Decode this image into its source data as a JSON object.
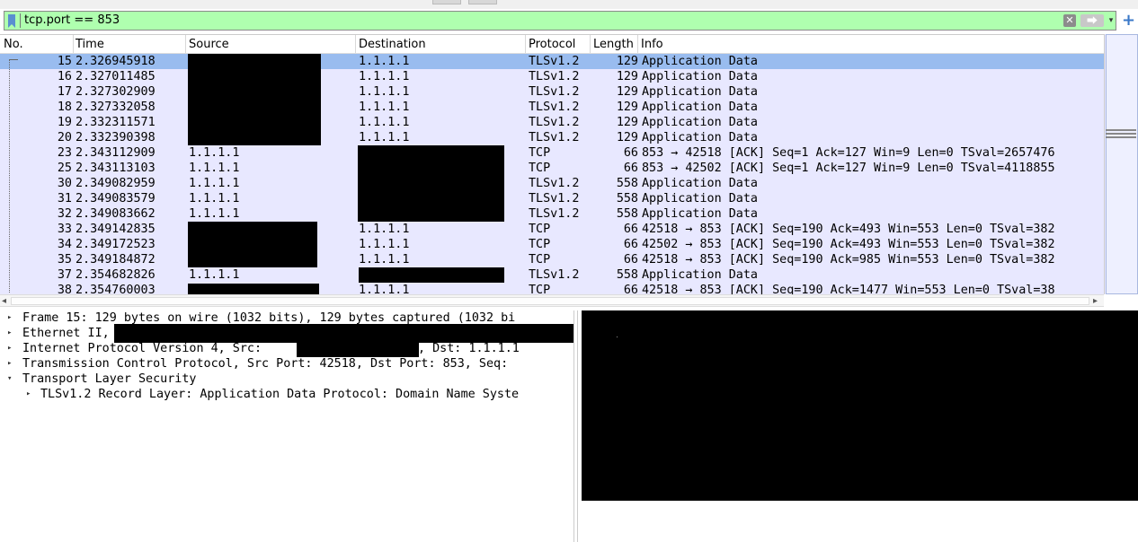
{
  "filter": {
    "text": "tcp.port == 853",
    "clear_icon": "✕",
    "apply_icon": "⮕",
    "dropdown_icon": "▾",
    "add_icon": "+"
  },
  "columns": {
    "no": "No.",
    "time": "Time",
    "source": "Source",
    "destination": "Destination",
    "protocol": "Protocol",
    "length": "Length",
    "info": "Info"
  },
  "packets": [
    {
      "no": "15",
      "time": "2.326945918",
      "source": "",
      "destination": "1.1.1.1",
      "protocol": "TLSv1.2",
      "length": "129",
      "info": "Application Data"
    },
    {
      "no": "16",
      "time": "2.327011485",
      "source": "",
      "destination": "1.1.1.1",
      "protocol": "TLSv1.2",
      "length": "129",
      "info": "Application Data"
    },
    {
      "no": "17",
      "time": "2.327302909",
      "source": "",
      "destination": "1.1.1.1",
      "protocol": "TLSv1.2",
      "length": "129",
      "info": "Application Data"
    },
    {
      "no": "18",
      "time": "2.327332058",
      "source": "",
      "destination": "1.1.1.1",
      "protocol": "TLSv1.2",
      "length": "129",
      "info": "Application Data"
    },
    {
      "no": "19",
      "time": "2.332311571",
      "source": "",
      "destination": "1.1.1.1",
      "protocol": "TLSv1.2",
      "length": "129",
      "info": "Application Data"
    },
    {
      "no": "20",
      "time": "2.332390398",
      "source": "",
      "destination": "1.1.1.1",
      "protocol": "TLSv1.2",
      "length": "129",
      "info": "Application Data"
    },
    {
      "no": "23",
      "time": "2.343112909",
      "source": "1.1.1.1",
      "destination": "",
      "protocol": "TCP",
      "length": "66",
      "info": "853 → 42518 [ACK] Seq=1 Ack=127 Win=9 Len=0 TSval=2657476"
    },
    {
      "no": "25",
      "time": "2.343113103",
      "source": "1.1.1.1",
      "destination": "",
      "protocol": "TCP",
      "length": "66",
      "info": "853 → 42502 [ACK] Seq=1 Ack=127 Win=9 Len=0 TSval=4118855"
    },
    {
      "no": "30",
      "time": "2.349082959",
      "source": "1.1.1.1",
      "destination": "",
      "protocol": "TLSv1.2",
      "length": "558",
      "info": "Application Data"
    },
    {
      "no": "31",
      "time": "2.349083579",
      "source": "1.1.1.1",
      "destination": "",
      "protocol": "TLSv1.2",
      "length": "558",
      "info": "Application Data"
    },
    {
      "no": "32",
      "time": "2.349083662",
      "source": "1.1.1.1",
      "destination": "",
      "protocol": "TLSv1.2",
      "length": "558",
      "info": "Application Data"
    },
    {
      "no": "33",
      "time": "2.349142835",
      "source": "",
      "destination": "1.1.1.1",
      "protocol": "TCP",
      "length": "66",
      "info": "42518 → 853 [ACK] Seq=190 Ack=493 Win=553 Len=0 TSval=382"
    },
    {
      "no": "34",
      "time": "2.349172523",
      "source": "",
      "destination": "1.1.1.1",
      "protocol": "TCP",
      "length": "66",
      "info": "42502 → 853 [ACK] Seq=190 Ack=493 Win=553 Len=0 TSval=382"
    },
    {
      "no": "35",
      "time": "2.349184872",
      "source": "",
      "destination": "1.1.1.1",
      "protocol": "TCP",
      "length": "66",
      "info": "42518 → 853 [ACK] Seq=190 Ack=985 Win=553 Len=0 TSval=382"
    },
    {
      "no": "37",
      "time": "2.354682826",
      "source": "1.1.1.1",
      "destination": "",
      "protocol": "TLSv1.2",
      "length": "558",
      "info": "Application Data"
    },
    {
      "no": "38",
      "time": "2.354760003",
      "source": "",
      "destination": "1.1.1.1",
      "protocol": "TCP",
      "length": "66",
      "info": "42518 → 853 [ACK] Seq=190 Ack=1477 Win=553 Len=0 TSval=38"
    }
  ],
  "details": [
    {
      "arrow": "▸",
      "text": "Frame 15: 129 bytes on wire (1032 bits), 129 bytes captured (1032 bi"
    },
    {
      "arrow": "▸",
      "text": "Ethernet II,"
    },
    {
      "arrow": "▸",
      "text": "Internet Protocol Version 4, Src:",
      "text2": ", Dst: 1.1.1.1"
    },
    {
      "arrow": "▸",
      "text": "Transmission Control Protocol, Src Port: 42518, Dst Port: 853, Seq:"
    },
    {
      "arrow": "▾",
      "text": "Transport Layer Security"
    },
    {
      "arrow": "▸",
      "text": "TLSv1.2 Record Layer: Application Data Protocol: Domain Name Syste"
    }
  ]
}
